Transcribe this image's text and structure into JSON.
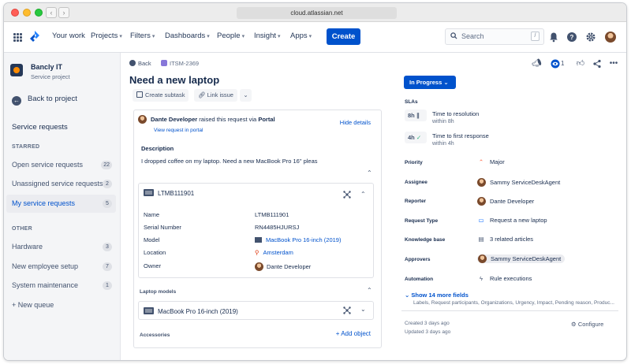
{
  "browser": {
    "url": "cloud.atlassian.net"
  },
  "topnav": {
    "items": [
      {
        "label": "Your work",
        "dropdown": false
      },
      {
        "label": "Projects",
        "dropdown": true
      },
      {
        "label": "Filters",
        "dropdown": true
      },
      {
        "label": "Dashboards",
        "dropdown": true
      },
      {
        "label": "People",
        "dropdown": true
      },
      {
        "label": "Insight",
        "dropdown": true
      },
      {
        "label": "Apps",
        "dropdown": true
      }
    ],
    "create_label": "Create",
    "search_placeholder": "Search",
    "search_shortcut": "/"
  },
  "sidebar": {
    "project_name": "Bancly IT",
    "project_type": "Service project",
    "back_label": "Back to project",
    "heading": "Service requests",
    "starred_label": "STARRED",
    "starred": [
      {
        "label": "Open service requests",
        "count": "22",
        "active": false
      },
      {
        "label": "Unassigned service requests",
        "count": "2",
        "active": false
      },
      {
        "label": "My service requests",
        "count": "5",
        "active": true
      }
    ],
    "other_label": "OTHER",
    "other": [
      {
        "label": "Hardware",
        "count": "3"
      },
      {
        "label": "New employee setup",
        "count": "7"
      },
      {
        "label": "System maintenance",
        "count": "1"
      }
    ],
    "new_queue_label": "+ New queue"
  },
  "issue": {
    "back_label": "Back",
    "key": "ITSM-2369",
    "title": "Need a new laptop",
    "create_subtask_label": "Create subtask",
    "link_issue_label": "Link issue",
    "reporter_name": "Dante Developer",
    "raised_text": " raised this request via ",
    "channel": "Portal",
    "view_portal_label": "View request in portal",
    "hide_details_label": "Hide details",
    "description_label": "Description",
    "description_text": "I dropped coffee on my laptop. Need a new MacBook Pro 16\" pleas",
    "asset": {
      "header": "LTMB111901",
      "fields": [
        {
          "label": "Name",
          "value": "LTMB111901"
        },
        {
          "label": "Serial Number",
          "value": "RN4485HJURSJ"
        },
        {
          "label": "Model",
          "value": "MacBook Pro 16-inch (2019)"
        },
        {
          "label": "Location",
          "value": "Amsterdam"
        },
        {
          "label": "Owner",
          "value": "Dante Developer"
        }
      ]
    },
    "laptop_models_label": "Laptop models",
    "laptop_model": "MacBook Pro 16-inch (2019)",
    "accessories_label": "Accessories",
    "add_object_label": "+ Add object"
  },
  "details": {
    "watchers": "1",
    "status": "In Progress",
    "slas_label": "SLAs",
    "slas": [
      {
        "time": "8h",
        "title": "Time to resolution",
        "sub": "within 8h"
      },
      {
        "time": "4h",
        "title": "Time to first response",
        "sub": "within 4h"
      }
    ],
    "fields": [
      {
        "label": "Priority",
        "value": "Major"
      },
      {
        "label": "Assignee",
        "value": "Sammy ServiceDeskAgent"
      },
      {
        "label": "Reporter",
        "value": "Dante Developer"
      },
      {
        "label": "Request Type",
        "value": "Request a new laptop"
      },
      {
        "label": "Knowledge base",
        "value": "3 related articles"
      },
      {
        "label": "Approvers",
        "value": "Sammy ServiceDeskAgent"
      },
      {
        "label": "Automation",
        "value": "Rule executions"
      }
    ],
    "show_more_label": "Show 14 more fields",
    "show_more_sub": "Labels, Request participants, Organizations, Urgency, Impact, Pending reason, Produc...",
    "created": "Created 3 days ago",
    "updated": "Updated 3 days ago",
    "configure_label": "Configure"
  },
  "colors": {
    "brand": "#0052cc",
    "sidebar_bg": "#f4f5f7",
    "text": "#172b4d"
  }
}
